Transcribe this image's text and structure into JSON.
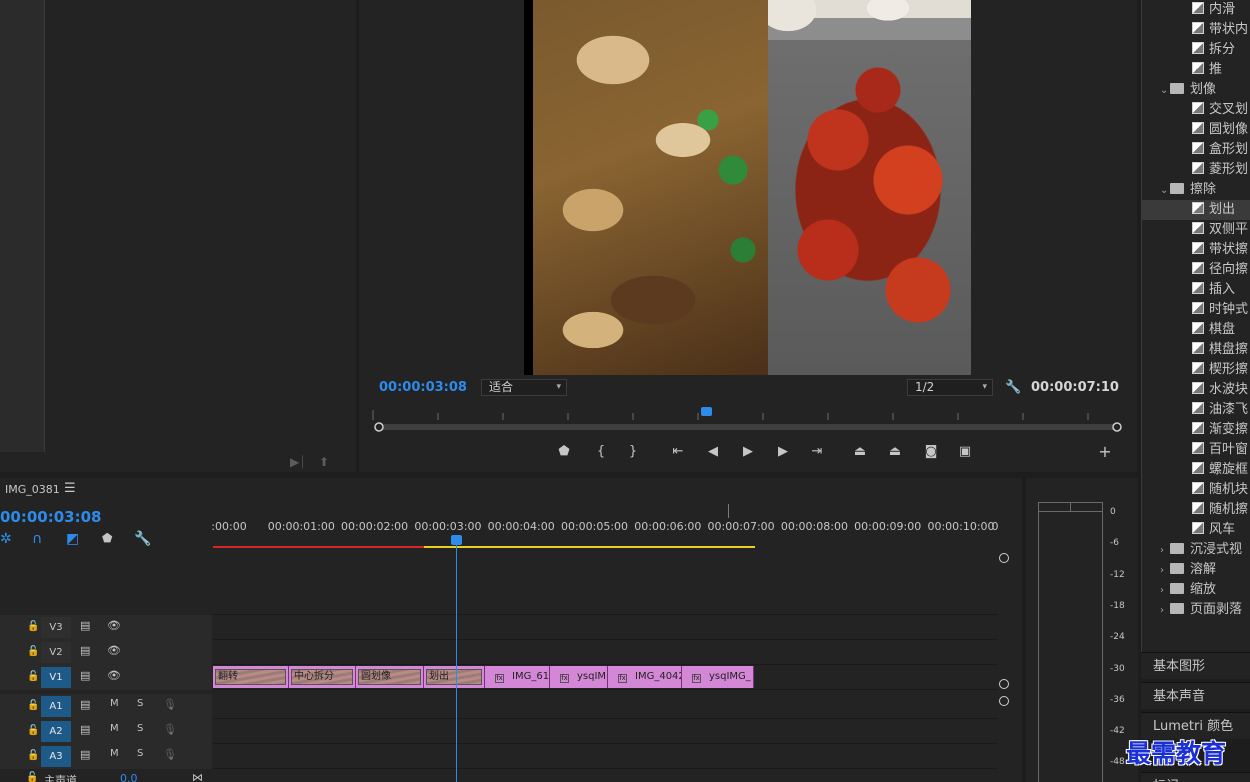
{
  "program": {
    "current_timecode": "00:00:03:08",
    "fit_label": "适合",
    "resolution_label": "1/2",
    "duration_timecode": "00:00:07:10"
  },
  "timeline": {
    "sequence_name": "IMG_0381",
    "menu_icon": "hamburger-icon",
    "timecode": "00:00:03:08",
    "ticks": [
      ":00:00",
      "00:00:01:00",
      "00:00:02:00",
      "00:00:03:00",
      "00:00:04:00",
      "00:00:05:00",
      "00:00:06:00",
      "00:00:07:00",
      "00:00:08:00",
      "00:00:09:00",
      "00:00:10:00",
      "0"
    ],
    "tracks": [
      {
        "label": "V3",
        "target": false,
        "m": "",
        "s": ""
      },
      {
        "label": "V2",
        "target": false,
        "m": "",
        "s": ""
      },
      {
        "label": "V1",
        "target": true,
        "m": "",
        "s": ""
      },
      {
        "label": "A1",
        "target": true,
        "m": "M",
        "s": "S"
      },
      {
        "label": "A2",
        "target": true,
        "m": "M",
        "s": "S"
      },
      {
        "label": "A3",
        "target": true,
        "m": "M",
        "s": "S"
      }
    ],
    "master_label": "主声道",
    "master_value": "0.0",
    "clips": [
      {
        "name": "翻转",
        "kind": "transition"
      },
      {
        "name": "中心拆分",
        "kind": "transition"
      },
      {
        "name": "圆划像",
        "kind": "transition"
      },
      {
        "name": "划出",
        "kind": "transition"
      },
      {
        "name": "IMG_61",
        "kind": "clip"
      },
      {
        "name": "ysqIM",
        "kind": "clip"
      },
      {
        "name": "IMG_4042",
        "kind": "clip"
      },
      {
        "name": "ysqIMG_",
        "kind": "clip"
      }
    ]
  },
  "effects": {
    "rows": [
      {
        "type": "fx",
        "label": "内滑",
        "indent": 2,
        "selected": false
      },
      {
        "type": "fx",
        "label": "带状内",
        "indent": 2,
        "selected": false
      },
      {
        "type": "fx",
        "label": "拆分",
        "indent": 2,
        "selected": false
      },
      {
        "type": "fx",
        "label": "推",
        "indent": 2,
        "selected": false
      },
      {
        "type": "folder",
        "label": "划像",
        "indent": 1,
        "open": true
      },
      {
        "type": "fx",
        "label": "交叉划",
        "indent": 2,
        "selected": false
      },
      {
        "type": "fx",
        "label": "圆划像",
        "indent": 2,
        "selected": false
      },
      {
        "type": "fx",
        "label": "盒形划",
        "indent": 2,
        "selected": false
      },
      {
        "type": "fx",
        "label": "菱形划",
        "indent": 2,
        "selected": false
      },
      {
        "type": "folder",
        "label": "擦除",
        "indent": 1,
        "open": true
      },
      {
        "type": "fx",
        "label": "划出",
        "indent": 2,
        "selected": true
      },
      {
        "type": "fx",
        "label": "双侧平",
        "indent": 2,
        "selected": false
      },
      {
        "type": "fx",
        "label": "带状擦",
        "indent": 2,
        "selected": false
      },
      {
        "type": "fx",
        "label": "径向擦",
        "indent": 2,
        "selected": false
      },
      {
        "type": "fx",
        "label": "插入",
        "indent": 2,
        "selected": false
      },
      {
        "type": "fx",
        "label": "时钟式",
        "indent": 2,
        "selected": false
      },
      {
        "type": "fx",
        "label": "棋盘",
        "indent": 2,
        "selected": false
      },
      {
        "type": "fx",
        "label": "棋盘擦",
        "indent": 2,
        "selected": false
      },
      {
        "type": "fx",
        "label": "楔形擦",
        "indent": 2,
        "selected": false
      },
      {
        "type": "fx",
        "label": "水波块",
        "indent": 2,
        "selected": false
      },
      {
        "type": "fx",
        "label": "油漆飞",
        "indent": 2,
        "selected": false
      },
      {
        "type": "fx",
        "label": "渐变擦",
        "indent": 2,
        "selected": false
      },
      {
        "type": "fx",
        "label": "百叶窗",
        "indent": 2,
        "selected": false
      },
      {
        "type": "fx",
        "label": "螺旋框",
        "indent": 2,
        "selected": false
      },
      {
        "type": "fx",
        "label": "随机块",
        "indent": 2,
        "selected": false
      },
      {
        "type": "fx",
        "label": "随机擦",
        "indent": 2,
        "selected": false
      },
      {
        "type": "fx",
        "label": "风车",
        "indent": 2,
        "selected": false
      },
      {
        "type": "folder",
        "label": "沉浸式视",
        "indent": 1,
        "open": false
      },
      {
        "type": "folder",
        "label": "溶解",
        "indent": 1,
        "open": false
      },
      {
        "type": "folder",
        "label": "缩放",
        "indent": 1,
        "open": false
      },
      {
        "type": "folder",
        "label": "页面剥落",
        "indent": 1,
        "open": false
      }
    ],
    "side_buttons": [
      "基本图形",
      "基本声音",
      "Lumetri 颜色",
      "标记"
    ]
  },
  "meter": {
    "db_labels": [
      "0",
      "-6",
      "-12",
      "-18",
      "-24",
      "-30",
      "-36",
      "-42",
      "-48"
    ]
  },
  "watermark": "最需教育"
}
